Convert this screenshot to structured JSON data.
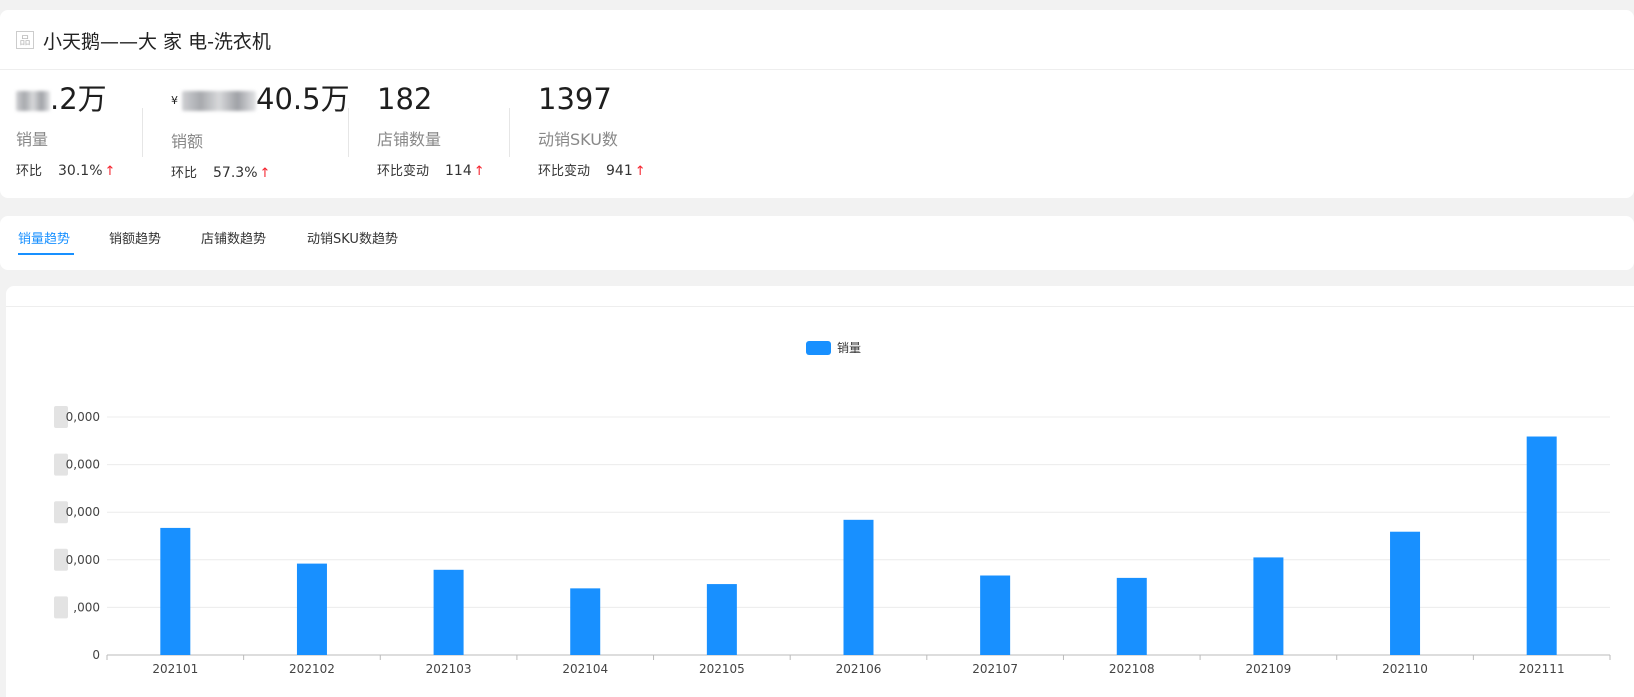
{
  "header": {
    "title": "小天鹅——大 家 电-洗衣机",
    "title_icon": "product-icon"
  },
  "metrics": [
    {
      "value_suffix": ".2万",
      "label": "销量",
      "change_label": "环比",
      "change_value": "30.1%",
      "trend": "up"
    },
    {
      "currency": "¥",
      "value_suffix": "40.5万",
      "label": "销额",
      "change_label": "环比",
      "change_value": "57.3%",
      "trend": "up"
    },
    {
      "value": "182",
      "label": "店铺数量",
      "change_label": "环比变动",
      "change_value": "114",
      "trend": "up"
    },
    {
      "value": "1397",
      "label": "动销SKU数",
      "change_label": "环比变动",
      "change_value": "941",
      "trend": "up"
    }
  ],
  "tabs": [
    {
      "label": "销量趋势",
      "active": true
    },
    {
      "label": "销额趋势",
      "active": false
    },
    {
      "label": "店铺数趋势",
      "active": false
    },
    {
      "label": "动销SKU数趋势",
      "active": false
    }
  ],
  "colors": {
    "accent": "#1890ff",
    "trend_up": "#f5222d"
  },
  "chart_data": {
    "type": "bar",
    "legend": [
      "销量"
    ],
    "legend_position": "top-center",
    "categories": [
      "202101",
      "202102",
      "202103",
      "202104",
      "202105",
      "202106",
      "202107",
      "202108",
      "202109",
      "202110",
      "202111"
    ],
    "series": [
      {
        "name": "销量",
        "color": "#1890ff",
        "values": [
          2.67,
          1.92,
          1.79,
          1.4,
          1.49,
          2.84,
          1.67,
          1.62,
          2.05,
          2.59,
          4.59
        ]
      }
    ],
    "y_tick_labels": [
      ",000",
      "0,000",
      "0,000",
      "0,000",
      "0,000",
      "0,000"
    ],
    "ylim": [
      0,
      5
    ],
    "grid": true
  }
}
